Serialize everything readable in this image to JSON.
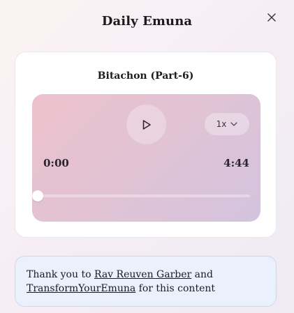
{
  "modal": {
    "title": "Daily Emuna",
    "close_icon": "close-icon"
  },
  "track": {
    "title": "Bitachon (Part-6)"
  },
  "player": {
    "play_icon": "play-icon",
    "speed_label": "1x",
    "speed_icon": "chevron-down-icon",
    "current_time": "0:00",
    "total_time": "4:44",
    "progress_fraction": 0.0
  },
  "credit": {
    "prefix": "Thank you to",
    "author_link": "Rav Reuven Garber",
    "connector": "and",
    "source_link": "TransformYourEmuna",
    "suffix": "for this content"
  },
  "colors": {
    "player_gradient_start": "#ecc1cb",
    "player_gradient_end": "#d3c3de",
    "credit_background": "#eaf1fc",
    "credit_border": "#c7d9f2"
  }
}
